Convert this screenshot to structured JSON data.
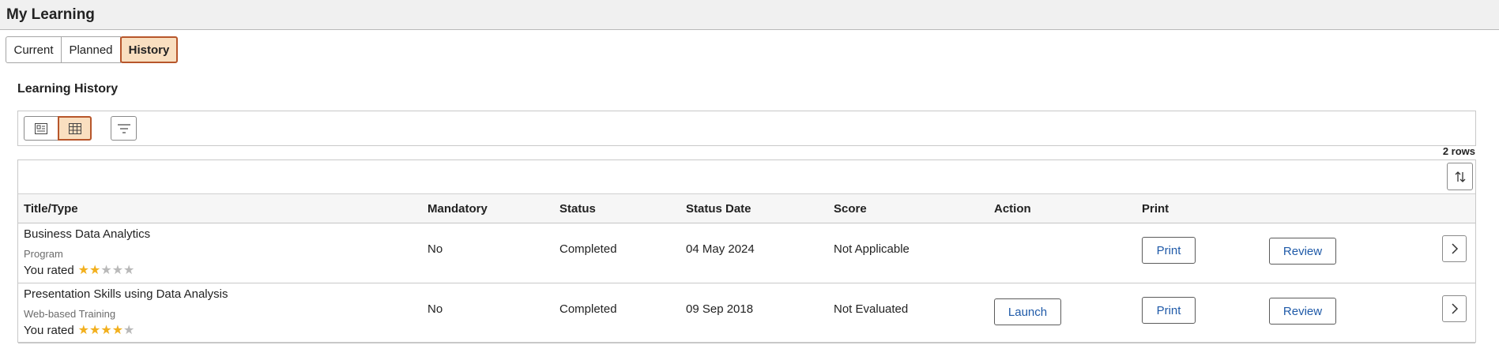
{
  "page": {
    "title": "My Learning"
  },
  "tabs": [
    {
      "label": "Current",
      "selected": false
    },
    {
      "label": "Planned",
      "selected": false
    },
    {
      "label": "History",
      "selected": true
    }
  ],
  "section": {
    "title": "Learning History"
  },
  "toolbar": {
    "icons": [
      "card-view-icon",
      "grid-view-icon",
      "filter-icon"
    ],
    "selected_view": "grid"
  },
  "grid": {
    "row_count": "2 rows",
    "sort_icon": "sort-icon",
    "columns": [
      "Title/Type",
      "Mandatory",
      "Status",
      "Status Date",
      "Score",
      "Action",
      "Print"
    ],
    "rows": [
      {
        "title": "Business Data Analytics",
        "type": "Program",
        "rated_label": "You rated",
        "rating": 2,
        "rating_max": 5,
        "mandatory": "No",
        "status": "Completed",
        "status_date": "04 May 2024",
        "score": "Not Applicable",
        "action": "",
        "print_label": "Print",
        "review_label": "Review"
      },
      {
        "title": "Presentation Skills using Data Analysis",
        "type": "Web-based Training",
        "rated_label": "You rated",
        "rating": 4,
        "rating_max": 5,
        "mandatory": "No",
        "status": "Completed",
        "status_date": "09 Sep 2018",
        "score": "Not Evaluated",
        "action": "Launch",
        "print_label": "Print",
        "review_label": "Review"
      }
    ]
  },
  "colors": {
    "accent_bg": "#f9dfc0",
    "accent_border": "#b7562b",
    "link": "#1f5aa8",
    "star_on": "#f2b01e",
    "star_off": "#b9b9b9"
  }
}
